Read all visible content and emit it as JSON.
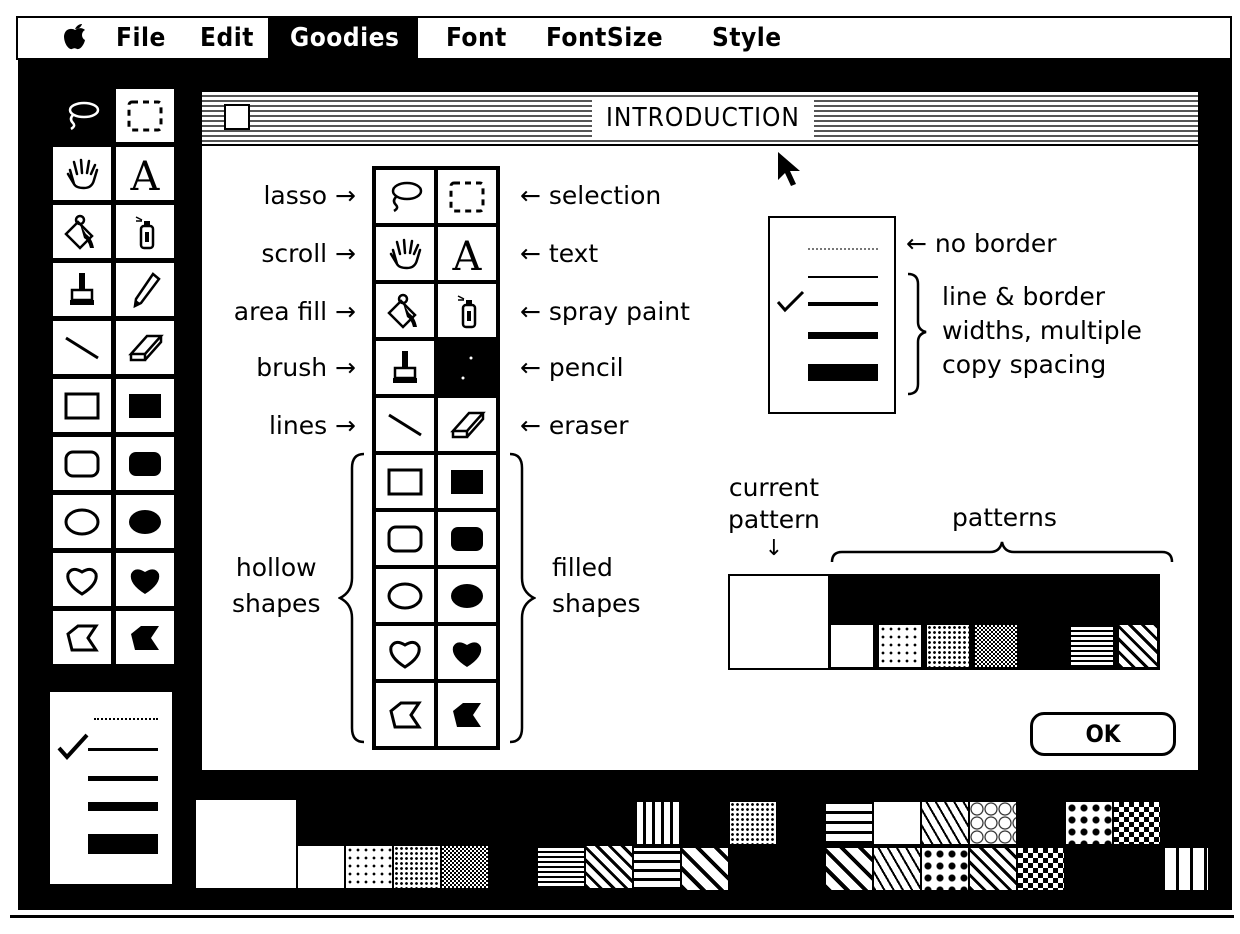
{
  "menubar": {
    "apple_icon": "apple-icon",
    "items": [
      {
        "label": "File",
        "active": false
      },
      {
        "label": "Edit",
        "active": false
      },
      {
        "label": "Goodies",
        "active": true
      },
      {
        "label": "Font",
        "active": false
      },
      {
        "label": "FontSize",
        "active": false
      },
      {
        "label": "Style",
        "active": false
      }
    ]
  },
  "tool_palette": {
    "selected": "lasso",
    "tools": [
      [
        "lasso",
        "selection"
      ],
      [
        "scroll",
        "text"
      ],
      [
        "area fill",
        "spray paint"
      ],
      [
        "brush",
        "pencil"
      ],
      [
        "lines",
        "eraser"
      ],
      [
        "hollow rectangle",
        "filled rectangle"
      ],
      [
        "hollow rounded rectangle",
        "filled rounded rectangle"
      ],
      [
        "hollow oval",
        "filled oval"
      ],
      [
        "hollow freeform",
        "filled freeform"
      ],
      [
        "hollow polygon",
        "filled polygon"
      ]
    ]
  },
  "line_widths": {
    "options": [
      "no border",
      "1",
      "2",
      "3",
      "4"
    ],
    "selected_index": 1
  },
  "dialog": {
    "title": "INTRODUCTION",
    "tool_labels_left": [
      "lasso →",
      "scroll →",
      "area fill →",
      "brush →",
      "lines →"
    ],
    "tool_labels_right": [
      "← selection",
      "← text",
      "← spray paint",
      "← pencil",
      "← eraser"
    ],
    "hollow_label": [
      "hollow",
      "shapes"
    ],
    "filled_label": [
      "filled",
      "shapes"
    ],
    "highlighted_tool": "pencil",
    "border_legend": {
      "no_border": "← no border",
      "description": [
        "line & border",
        "widths, multiple",
        "copy spacing"
      ],
      "selected_index": 1
    },
    "current_pattern_label": [
      "current",
      "pattern"
    ],
    "current_pattern_arrow": "↓",
    "patterns_label": "patterns",
    "ok_label": "OK"
  },
  "cursor": "arrow-pointer",
  "bottom_patterns": {
    "current": "weave",
    "row1": [
      "vertical-lines",
      "wavy",
      "fine-dots",
      "grid",
      "brick",
      "white-sparse",
      "diagonal-dashes",
      "scales",
      "weave",
      "bubbles",
      "mesh",
      "dots-large"
    ],
    "row2_left": [
      "white",
      "sparse-dots",
      "dots",
      "fine",
      "grid-fine",
      "horizontal-lines",
      "diagonal"
    ],
    "row2": [
      "horizontal-wide",
      "diagonal-wide",
      "lattice",
      "squares",
      "zigzag-blocks",
      "chevron",
      "spots",
      "diag-dash",
      "triangles",
      "wave",
      "dots-scatter",
      "curtain"
    ]
  }
}
